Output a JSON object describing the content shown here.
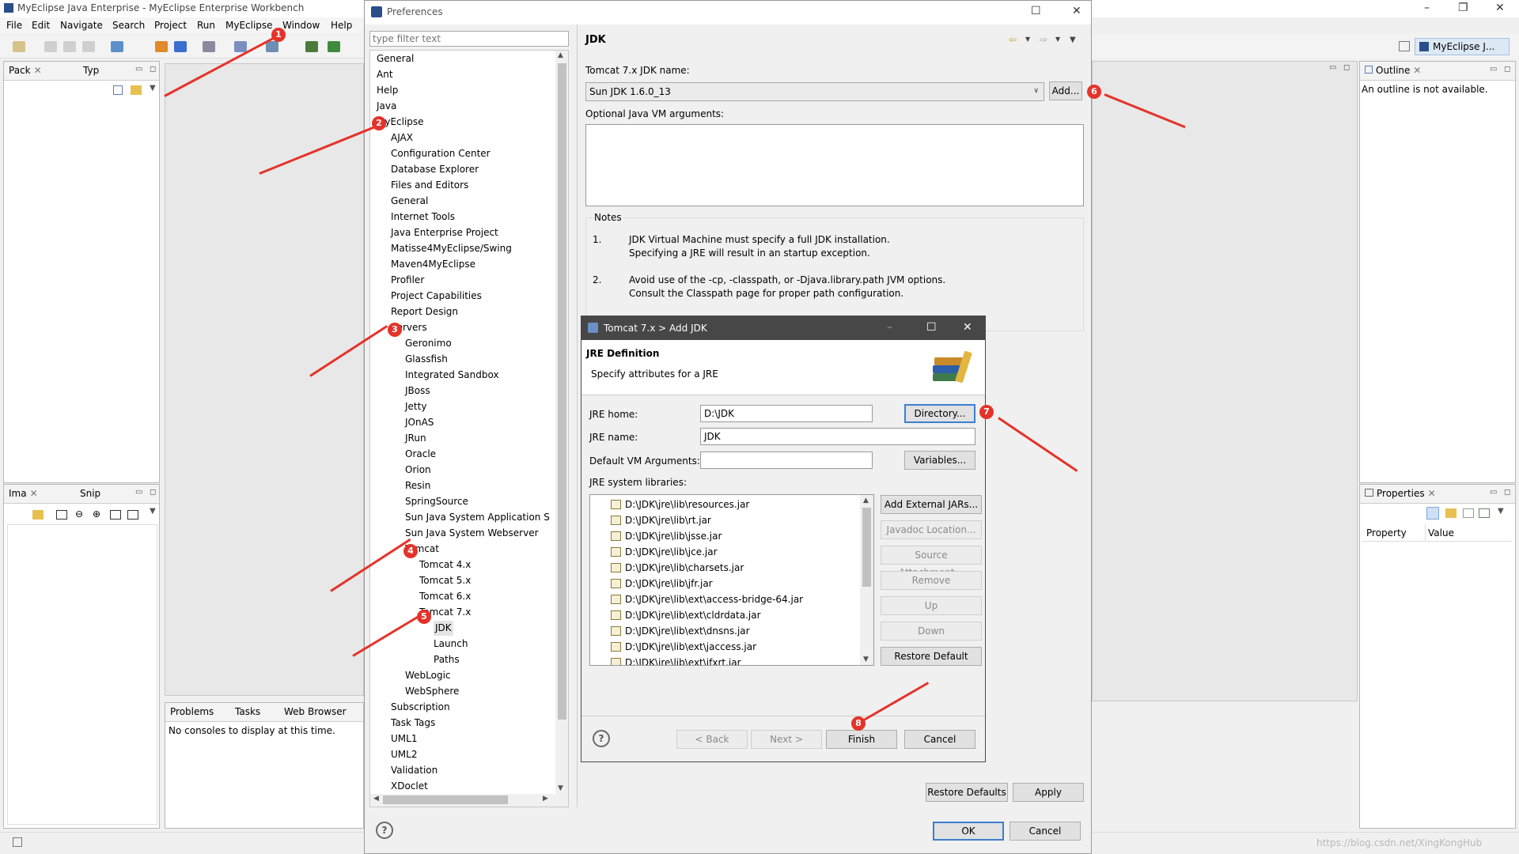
{
  "workbench": {
    "title": "MyEclipse Java Enterprise - MyEclipse Enterprise Workbench",
    "menu": [
      "File",
      "Edit",
      "Navigate",
      "Search",
      "Project",
      "Run",
      "MyEclipse",
      "Window",
      "Help"
    ],
    "perspective": "MyEclipse J...",
    "views": {
      "pack": "Pack",
      "typ": "Typ",
      "ima": "Ima",
      "snip": "Snip",
      "outline": "Outline",
      "outline_msg": "An outline is not available.",
      "properties": "Properties",
      "prop_col": "Property",
      "value_col": "Value",
      "problems": "Problems",
      "tasks": "Tasks",
      "web_browser": "Web Browser",
      "console_msg": "No consoles to display at this time."
    },
    "watermark": "https://blog.csdn.net/XingKongHub"
  },
  "prefs": {
    "title": "Preferences",
    "filter_placeholder": "type filter text",
    "tree": [
      {
        "label": "General",
        "level": 0
      },
      {
        "label": "Ant",
        "level": 0
      },
      {
        "label": "Help",
        "level": 0
      },
      {
        "label": "Java",
        "level": 0
      },
      {
        "label": "MyEclipse",
        "level": 0
      },
      {
        "label": "AJAX",
        "level": 1
      },
      {
        "label": "Configuration Center",
        "level": 1
      },
      {
        "label": "Database Explorer",
        "level": 1
      },
      {
        "label": "Files and Editors",
        "level": 1
      },
      {
        "label": "General",
        "level": 1
      },
      {
        "label": "Internet Tools",
        "level": 1
      },
      {
        "label": "Java Enterprise Project",
        "level": 1
      },
      {
        "label": "Matisse4MyEclipse/Swing",
        "level": 1
      },
      {
        "label": "Maven4MyEclipse",
        "level": 1
      },
      {
        "label": "Profiler",
        "level": 1
      },
      {
        "label": "Project Capabilities",
        "level": 1
      },
      {
        "label": "Report Design",
        "level": 1
      },
      {
        "label": "Servers",
        "level": 1
      },
      {
        "label": "Geronimo",
        "level": 2
      },
      {
        "label": "Glassfish",
        "level": 2
      },
      {
        "label": "Integrated Sandbox",
        "level": 2
      },
      {
        "label": "JBoss",
        "level": 2
      },
      {
        "label": "Jetty",
        "level": 2
      },
      {
        "label": "JOnAS",
        "level": 2
      },
      {
        "label": "JRun",
        "level": 2
      },
      {
        "label": "Oracle",
        "level": 2
      },
      {
        "label": "Orion",
        "level": 2
      },
      {
        "label": "Resin",
        "level": 2
      },
      {
        "label": "SpringSource",
        "level": 2
      },
      {
        "label": "Sun Java System Application S",
        "level": 2
      },
      {
        "label": "Sun Java System Webserver",
        "level": 2
      },
      {
        "label": "Tomcat",
        "level": 2
      },
      {
        "label": "Tomcat  4.x",
        "level": 3
      },
      {
        "label": "Tomcat  5.x",
        "level": 3
      },
      {
        "label": "Tomcat  6.x",
        "level": 3
      },
      {
        "label": "Tomcat  7.x",
        "level": 3
      },
      {
        "label": "JDK",
        "level": 4,
        "selected": true
      },
      {
        "label": "Launch",
        "level": 4
      },
      {
        "label": "Paths",
        "level": 4
      },
      {
        "label": "WebLogic",
        "level": 2
      },
      {
        "label": "WebSphere",
        "level": 2
      },
      {
        "label": "Subscription",
        "level": 1
      },
      {
        "label": "Task Tags",
        "level": 1
      },
      {
        "label": "UML1",
        "level": 1
      },
      {
        "label": "UML2",
        "level": 1
      },
      {
        "label": "Validation",
        "level": 1
      },
      {
        "label": "XDoclet",
        "level": 1
      }
    ],
    "page_title": "JDK",
    "jdk_name_label": "Tomcat  7.x JDK name:",
    "jdk_name_value": "Sun JDK 1.6.0_13",
    "add_button": "Add...",
    "vm_args_label": "Optional Java VM arguments:",
    "notes_title": "Notes",
    "notes": [
      {
        "num": "1.",
        "lines": [
          "JDK Virtual Machine must specify a full JDK installation.",
          "Specifying a JRE will result in an startup exception."
        ]
      },
      {
        "num": "2.",
        "lines": [
          "Avoid use of the -cp, -classpath, or -Djava.library.path JVM options.",
          "Consult the Classpath page for proper path configuration."
        ]
      }
    ],
    "restore_defaults": "Restore Defaults",
    "apply": "Apply",
    "ok": "OK",
    "cancel": "Cancel"
  },
  "dialog": {
    "title": "Tomcat  7.x > Add JDK",
    "header_title": "JRE Definition",
    "header_desc": "Specify attributes for a JRE",
    "jre_home_label": "JRE home:",
    "jre_home_value": "D:\\JDK",
    "directory_button": "Directory...",
    "jre_name_label": "JRE name:",
    "jre_name_value": "JDK",
    "vm_args_label": "Default VM Arguments:",
    "vm_args_value": "",
    "variables_button": "Variables...",
    "libs_label": "JRE system libraries:",
    "libraries": [
      "D:\\JDK\\jre\\lib\\resources.jar",
      "D:\\JDK\\jre\\lib\\rt.jar",
      "D:\\JDK\\jre\\lib\\jsse.jar",
      "D:\\JDK\\jre\\lib\\jce.jar",
      "D:\\JDK\\jre\\lib\\charsets.jar",
      "D:\\JDK\\jre\\lib\\jfr.jar",
      "D:\\JDK\\jre\\lib\\ext\\access-bridge-64.jar",
      "D:\\JDK\\jre\\lib\\ext\\cldrdata.jar",
      "D:\\JDK\\jre\\lib\\ext\\dnsns.jar",
      "D:\\JDK\\jre\\lib\\ext\\jaccess.jar",
      "D:\\JDK\\jre\\lib\\ext\\jfxrt.jar"
    ],
    "lib_buttons": {
      "add_external": "Add External JARs...",
      "javadoc": "Javadoc Location...",
      "source": "Source Attachment...",
      "remove": "Remove",
      "up": "Up",
      "down": "Down",
      "restore": "Restore Default"
    },
    "back": "< Back",
    "next": "Next >",
    "finish": "Finish",
    "cancel": "Cancel"
  },
  "annotations": [
    "1",
    "2",
    "3",
    "4",
    "5",
    "6",
    "7",
    "8"
  ],
  "colors": {
    "annotation": "#e5332a",
    "dialog_title_bg": "#474747",
    "default_button_border": "#3c7fd1"
  }
}
